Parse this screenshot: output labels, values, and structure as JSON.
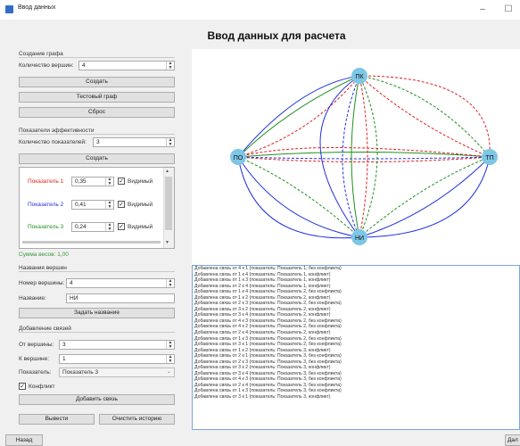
{
  "window": {
    "title": "Ввод данных",
    "minimize": "–",
    "maximize": "☐"
  },
  "heading": "Ввод данных для расчета",
  "graph_creation": {
    "title": "Создание графа",
    "vertex_count_label": "Количество вершин:",
    "vertex_count_value": "4",
    "create_button": "Создать",
    "test_graph_button": "Тестовый граф",
    "reset_button": "Сброс"
  },
  "efficiency": {
    "title": "Показатели эффективности",
    "count_label": "Количество показателей:",
    "count_value": "3",
    "create_button": "Создать",
    "visible_label": "Видимый",
    "indicators": [
      {
        "label": "Показатель 1",
        "value": "0,35",
        "color": "#e02020"
      },
      {
        "label": "Показатель 2",
        "value": "0,41",
        "color": "#2030e0"
      },
      {
        "label": "Показатель 3",
        "value": "0,24",
        "color": "#209020"
      }
    ],
    "weights_sum": "Сумма весов: 1,00",
    "weights_sum_color": "#3a9a3a"
  },
  "vertex_names": {
    "title": "Названия вершин",
    "number_label": "Номер вершины:",
    "number_value": "4",
    "name_label": "Название:",
    "name_value": "НИ",
    "set_button": "Задать название"
  },
  "add_edges": {
    "title": "Добавление связей",
    "from_label": "От вершины:",
    "from_value": "3",
    "to_label": "К вершине:",
    "to_value": "1",
    "indicator_label": "Показатель:",
    "indicator_value": "Показатель 3",
    "conflict_label": "Конфликт",
    "add_button": "Добавить связь"
  },
  "bottom_buttons": {
    "output": "Вывести",
    "clear_history": "Очистить историю"
  },
  "footer": {
    "back": "Назад",
    "next": "Дал"
  },
  "graph": {
    "nodes": [
      {
        "id": "pk",
        "label": "ПК"
      },
      {
        "id": "po",
        "label": "ПО"
      },
      {
        "id": "tp",
        "label": "ТП"
      },
      {
        "id": "ni",
        "label": "НИ"
      }
    ],
    "node_color": "#7ec6e6"
  },
  "log_lines": [
    "Добавлена связь от 4 к 1 (показатель: Показатель 1, без конфликта)",
    "Добавлена связь от 1 к 4 (показатель: Показатель 1, конфликт)",
    "Добавлена связь от 1 к 3 (показатель: Показатель 1, конфликт)",
    "Добавлена связь от 2 к 4 (показатель: Показатель 1, конфликт)",
    "Добавлена связь от 1 к 4 (показатель: Показатель 2, без конфликта)",
    "Добавлена связь от 1 к 2 (показатель: Показатель 2, конфликт)",
    "Добавлена связь от 2 к 3 (показатель: Показатель 2, без конфликта)",
    "Добавлена связь от 3 к 2 (показатель: Показатель 2, конфликт)",
    "Добавлена связь от 3 к 4 (показатель: Показатель 2, конфликт)",
    "Добавлена связь от 4 к 3 (показатель: Показатель 2, без конфликта)",
    "Добавлена связь от 4 к 2 (показатель: Показатель 2, без конфликта)",
    "Добавлена связь от 2 к 4 (показатель: Показатель 2, конфликт)",
    "Добавлена связь от 1 к 3 (показатель: Показатель 2, без конфликта)",
    "Добавлена связь от 3 к 1 (показатель: Показатель 2, без конфликта)",
    "Добавлена связь от 1 к 2 (показатель: Показатель 3, конфликт)",
    "Добавлена связь от 2 к 1 (показатель: Показатель 3, без конфликта)",
    "Добавлена связь от 2 к 3 (показатель: Показатель 3, без конфликта)",
    "Добавлена связь от 3 к 2 (показатель: Показатель 3, конфликт)",
    "Добавлена связь от 3 к 4 (показатель: Показатель 3, без конфликта)",
    "Добавлена связь от 4 к 3 (показатель: Показатель 3, без конфликта)",
    "Добавлена связь от 2 к 4 (показатель: Показатель 3, без конфликта)",
    "Добавлена связь от 1 к 3 (показатель: Показатель 3, без конфликта)",
    "Добавлена связь от 3 к 1 (показатель: Показатель 3, конфликт)"
  ]
}
